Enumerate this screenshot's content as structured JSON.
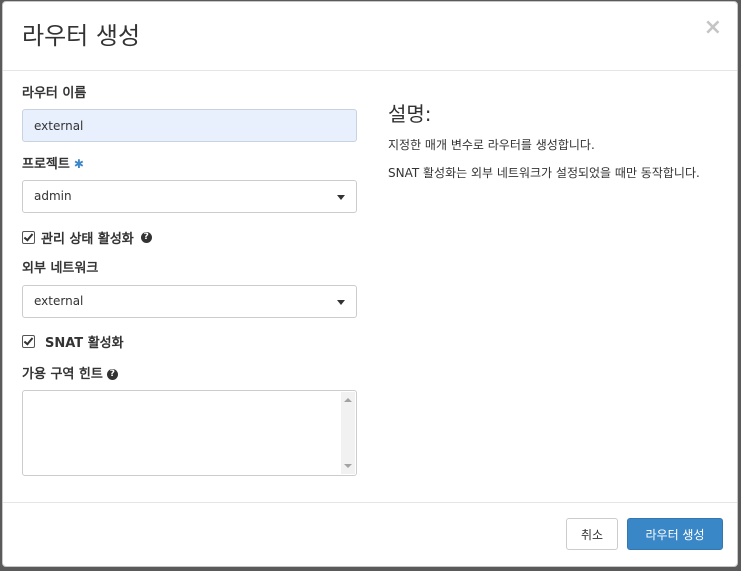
{
  "dialog": {
    "title": "라우터 생성",
    "close_symbol": "×"
  },
  "form": {
    "router_name": {
      "label": "라우터 이름",
      "value": "external"
    },
    "project": {
      "label": "프로젝트",
      "required_mark": "✱",
      "selected": "admin"
    },
    "admin_state": {
      "label": "관리 상태 활성화",
      "checked": true,
      "help_symbol": "?"
    },
    "external_network": {
      "label": "외부 네트워크",
      "selected": "external"
    },
    "snat": {
      "label": "SNAT 활성화",
      "checked": true
    },
    "availability_zone_hints": {
      "label": "가용 구역 힌트",
      "help_symbol": "?",
      "value": ""
    }
  },
  "description": {
    "title": "설명:",
    "paragraph1": "지정한 매개 변수로 라우터를 생성합니다.",
    "paragraph2": "SNAT 활성화는 외부 네트워크가 설정되었을 때만 동작합니다."
  },
  "footer": {
    "cancel_label": "취소",
    "submit_label": "라우터 생성"
  },
  "colors": {
    "primary": "#3a87c8",
    "required": "#3b87c8",
    "autofill_bg": "#e8f0fe"
  }
}
